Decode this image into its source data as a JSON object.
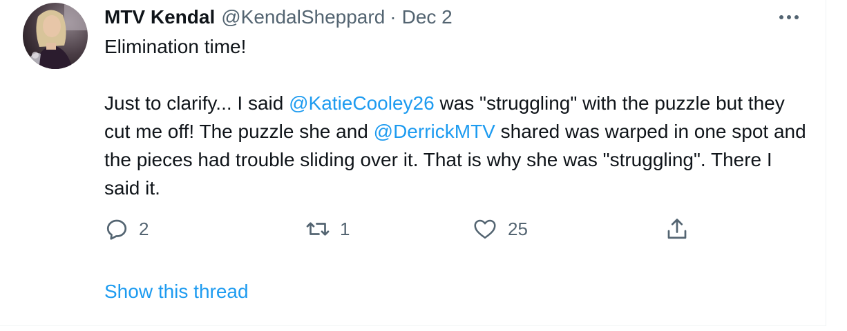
{
  "tweet": {
    "author": {
      "display_name": "MTV Kendal",
      "handle": "@KendalSheppard",
      "avatar": "avatar-photo"
    },
    "separator": "·",
    "date": "Dec 2",
    "text": {
      "line1": "Elimination time!",
      "p2_part1": "Just to clarify... I said ",
      "mention1": "@KatieCooley26",
      "p2_part2": " was \"struggling\" with the puzzle but they cut me off! The puzzle she and ",
      "mention2": "@DerrickMTV",
      "p2_part3": " shared was warped in one spot and the pieces had trouble sliding over it. That is why she was \"struggling\". There I said it."
    },
    "actions": {
      "reply": {
        "icon": "reply-icon",
        "count": "2"
      },
      "retweet": {
        "icon": "retweet-icon",
        "count": "1"
      },
      "like": {
        "icon": "heart-icon",
        "count": "25"
      },
      "share": {
        "icon": "share-icon"
      }
    },
    "more_icon": "more-options-icon",
    "show_thread": "Show this thread"
  },
  "colors": {
    "text": "#0f1419",
    "secondary": "#536471",
    "link": "#1d9bf0",
    "border": "#eff3f4"
  }
}
